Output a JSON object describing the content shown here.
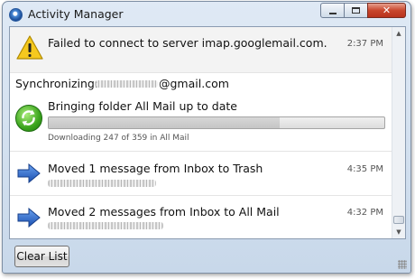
{
  "window": {
    "title": "Activity Manager",
    "icon": "thunderbird-icon",
    "controls": [
      "minimize-icon",
      "maximize-icon",
      "close-icon"
    ]
  },
  "activities": [
    {
      "icon": "warning-icon",
      "message": "Failed to connect to server imap.googlemail.com.",
      "time": "2:37 PM"
    },
    {
      "header_prefix": "Synchronizing:",
      "header_suffix": "@gmail.com",
      "icon": "sync-icon",
      "message": "Bringing folder All Mail up to date",
      "status": "Downloading 247 of 359 in All Mail",
      "progress": 0.688
    },
    {
      "icon": "arrow-right-icon",
      "message": "Moved 1 message from Inbox to Trash",
      "time": "4:35 PM"
    },
    {
      "icon": "arrow-right-icon",
      "message": "Moved 2 messages from Inbox to All Mail",
      "time": "4:32 PM"
    }
  ],
  "footer": {
    "clear_list_label": "Clear List"
  },
  "colors": {
    "titlebar": "#dfe9f5",
    "close_button": "#c9462c",
    "sync_green": "#3aa41c",
    "arrow_blue": "#1f5fc8"
  }
}
